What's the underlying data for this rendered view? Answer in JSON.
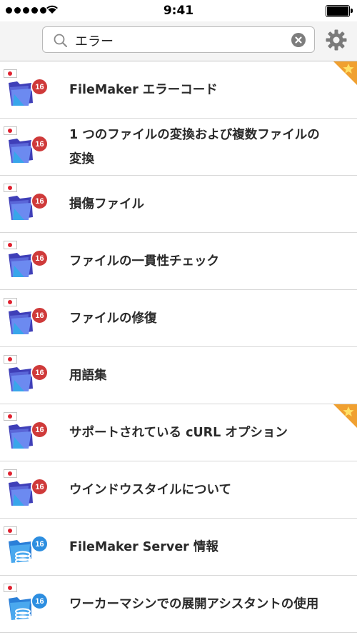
{
  "status": {
    "time": "9:41"
  },
  "search": {
    "value": "エラー"
  },
  "icons": {
    "search": "search-icon",
    "clear": "clear-icon",
    "settings": "gear-icon",
    "flag": "japan-flag-icon",
    "app_pro": "filemaker-pro-folder-icon",
    "app_server": "filemaker-server-icon",
    "favorite": "star-icon"
  },
  "colors": {
    "badge_red": "#cf3a3a",
    "badge_blue": "#2d8ee0",
    "star_orange": "#f0a030"
  },
  "items": [
    {
      "title": "FileMaker エラーコード",
      "badge": "16",
      "kind": "pro",
      "starred": true
    },
    {
      "title": "1 つのファイルの変換および複数ファイルの変換",
      "badge": "16",
      "kind": "pro",
      "starred": false
    },
    {
      "title": "損傷ファイル",
      "badge": "16",
      "kind": "pro",
      "starred": false
    },
    {
      "title": "ファイルの一貫性チェック",
      "badge": "16",
      "kind": "pro",
      "starred": false
    },
    {
      "title": "ファイルの修復",
      "badge": "16",
      "kind": "pro",
      "starred": false
    },
    {
      "title": "用語集",
      "badge": "16",
      "kind": "pro",
      "starred": false
    },
    {
      "title": "サポートされている cURL オプション",
      "badge": "16",
      "kind": "pro",
      "starred": true
    },
    {
      "title": "ウインドウスタイルについて",
      "badge": "16",
      "kind": "pro",
      "starred": false
    },
    {
      "title": "FileMaker Server 情報",
      "badge": "16",
      "kind": "server",
      "starred": false
    },
    {
      "title": "ワーカーマシンでの展開アシスタントの使用",
      "badge": "16",
      "kind": "server",
      "starred": false
    }
  ]
}
